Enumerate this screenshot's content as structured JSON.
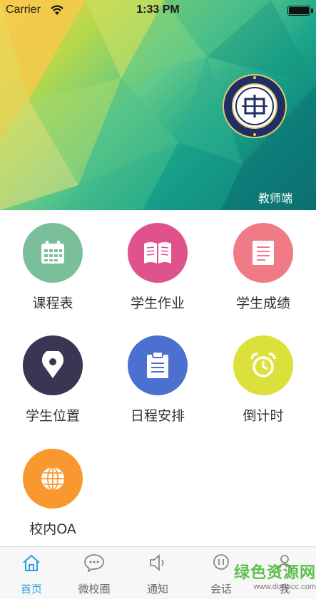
{
  "status_bar": {
    "carrier": "Carrier",
    "time": "1:33 PM"
  },
  "header": {
    "emblem": "school-emblem",
    "role_label": "教师端"
  },
  "grid": {
    "items": [
      {
        "label": "课程表",
        "icon": "calendar-icon",
        "color": "#7bbf9a"
      },
      {
        "label": "学生作业",
        "icon": "book-icon",
        "color": "#e0528b"
      },
      {
        "label": "学生成绩",
        "icon": "document-icon",
        "color": "#f07b87"
      },
      {
        "label": "学生位置",
        "icon": "location-pin-icon",
        "color": "#3b3453"
      },
      {
        "label": "日程安排",
        "icon": "clipboard-icon",
        "color": "#4b70cf"
      },
      {
        "label": "倒计时",
        "icon": "alarm-clock-icon",
        "color": "#dbe03a"
      },
      {
        "label": "校内OA",
        "icon": "globe-icon",
        "color": "#f8982f"
      }
    ]
  },
  "tabbar": {
    "tabs": [
      {
        "label": "首页",
        "icon": "home-icon",
        "active": true
      },
      {
        "label": "微校圈",
        "icon": "chat-bubble-icon",
        "active": false
      },
      {
        "label": "通知",
        "icon": "speaker-icon",
        "active": false
      },
      {
        "label": "会话",
        "icon": "conversation-icon",
        "active": false
      },
      {
        "label": "我",
        "icon": "person-icon",
        "active": false
      }
    ],
    "active_color": "#2aa0e0"
  },
  "watermark": {
    "title": "绿色资源网",
    "url": "www.downcc.com"
  }
}
